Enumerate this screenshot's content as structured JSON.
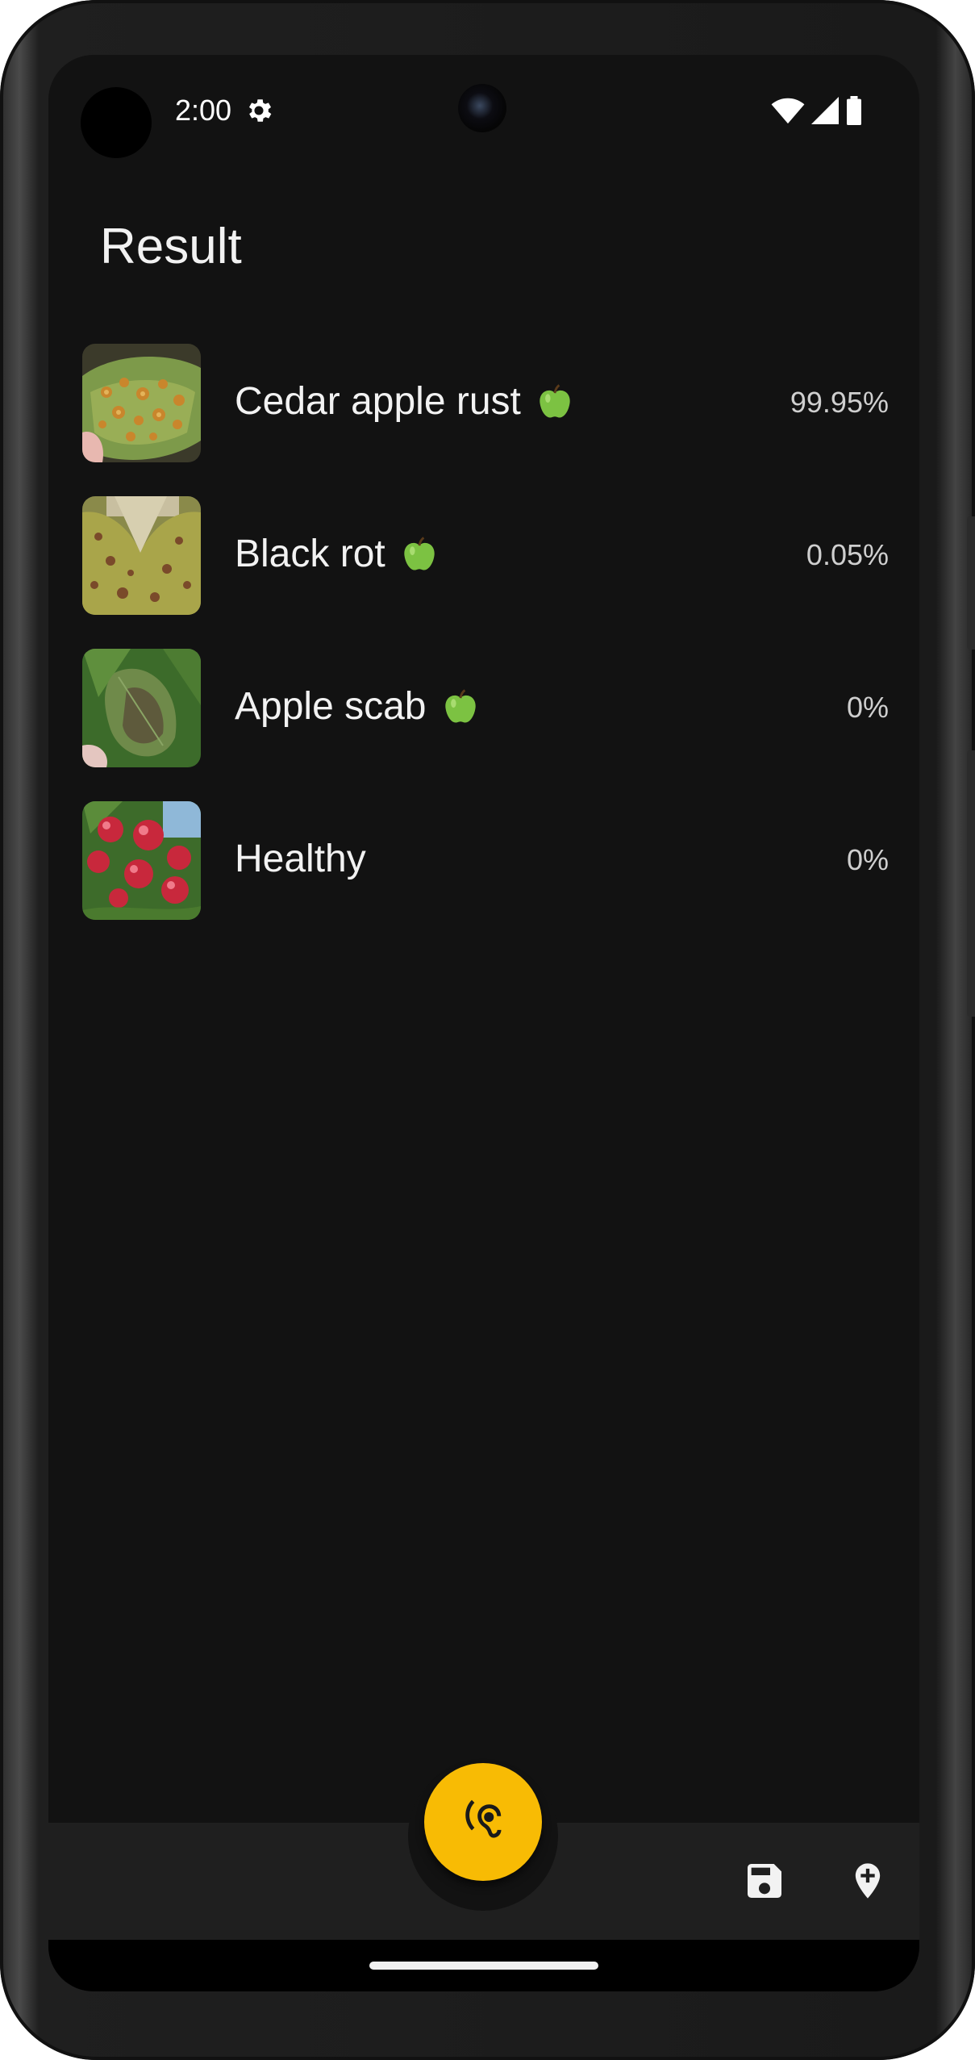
{
  "status_bar": {
    "time": "2:00",
    "icons": [
      "settings-gear-icon",
      "wifi-icon",
      "cellular-signal-icon",
      "battery-icon"
    ]
  },
  "page": {
    "title": "Result"
  },
  "results": [
    {
      "label": "Cedar apple rust",
      "percent": "99.95%",
      "has_apple_icon": true,
      "thumbnail": "cedar-apple-rust-leaf-image"
    },
    {
      "label": "Black rot",
      "percent": "0.05%",
      "has_apple_icon": true,
      "thumbnail": "black-rot-leaf-image"
    },
    {
      "label": "Apple scab",
      "percent": "0%",
      "has_apple_icon": true,
      "thumbnail": "apple-scab-leaf-image"
    },
    {
      "label": "Healthy",
      "percent": "0%",
      "has_apple_icon": false,
      "thumbnail": "healthy-apples-image"
    }
  ],
  "bottom_bar": {
    "fab_icon": "hearing-ear-icon",
    "actions": [
      "save-icon",
      "add-location-icon"
    ]
  },
  "colors": {
    "background": "#121212",
    "bottom_bar": "#1f1f1f",
    "fab": "#f8bb04",
    "text_primary": "#f2f2f2",
    "text_secondary": "#cfcfcf",
    "apple_green": "#7cc242"
  }
}
